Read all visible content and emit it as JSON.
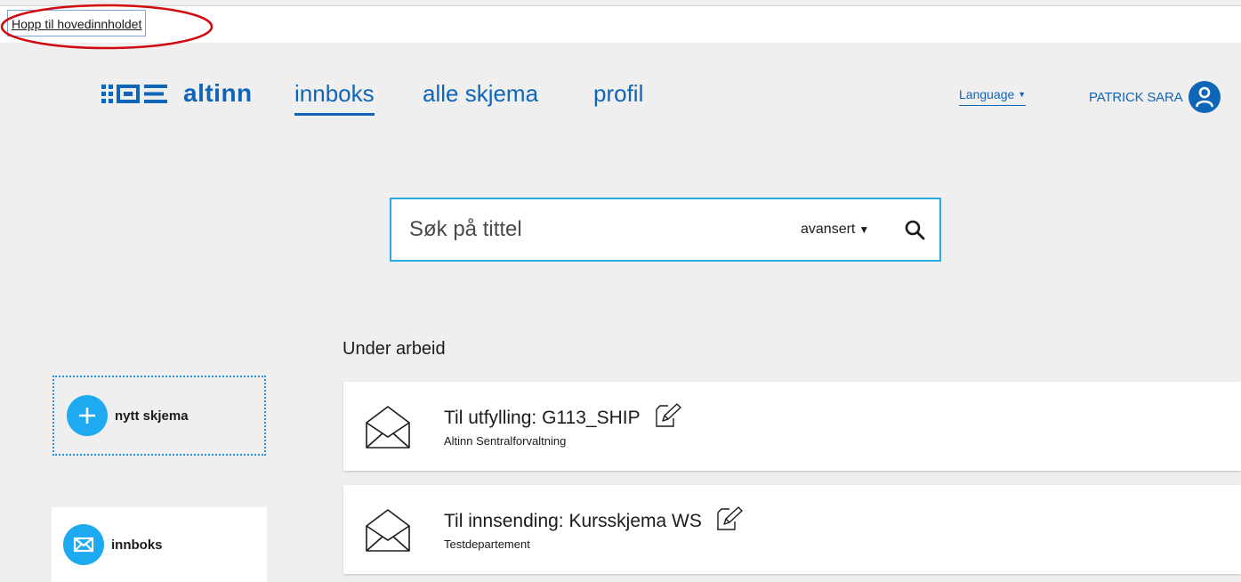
{
  "skip_link": "Hopp til hovedinnholdet",
  "brand": {
    "name": "altinn",
    "color": "#0f65b8"
  },
  "nav": {
    "items": [
      {
        "label": "innboks",
        "active": true
      },
      {
        "label": "alle skjema",
        "active": false
      },
      {
        "label": "profil",
        "active": false
      }
    ]
  },
  "language": {
    "label": "Language"
  },
  "user": {
    "name": "PATRICK SARA",
    "icon": "user-icon"
  },
  "search": {
    "placeholder": "Søk på tittel",
    "advanced_label": "avansert",
    "icon": "search-icon",
    "border_color": "#2aa8e0"
  },
  "sidebar": {
    "new_form": {
      "label": "nytt skjema",
      "icon": "plus-icon"
    },
    "inbox": {
      "label": "innboks",
      "icon": "envelope-icon"
    },
    "accent": "#1eaaf1"
  },
  "section": {
    "title": "Under arbeid"
  },
  "messages": [
    {
      "title": "Til utfylling: G113_SHIP",
      "sender": "Altinn Sentralforvaltning",
      "icon": "open-envelope-icon",
      "status_icon": "edit-icon"
    },
    {
      "title": "Til innsending: Kursskjema WS",
      "sender": "Testdepartement",
      "icon": "open-envelope-icon",
      "status_icon": "edit-icon"
    }
  ]
}
